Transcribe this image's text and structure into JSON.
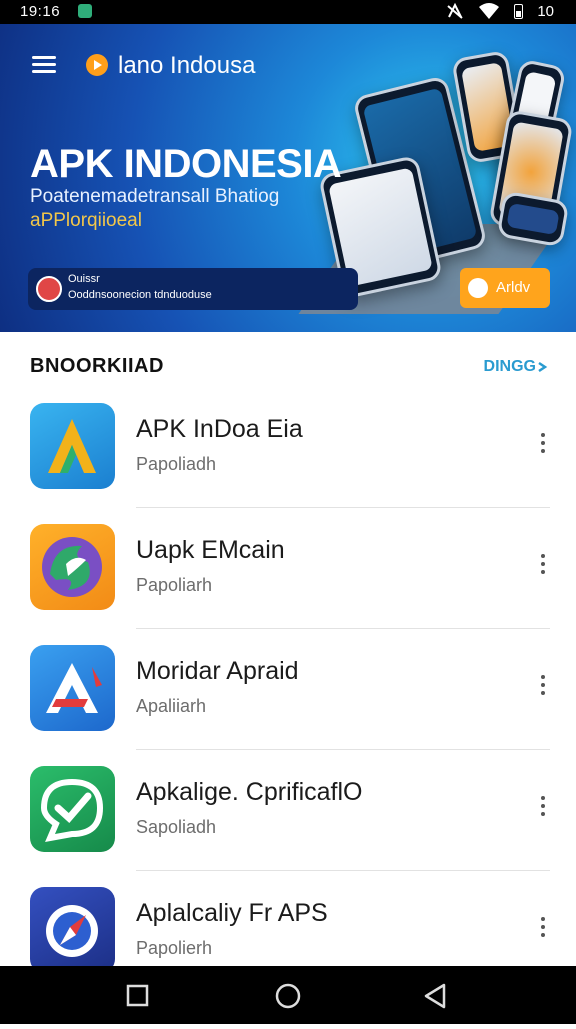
{
  "status_bar": {
    "time": "19:16",
    "battery": "10"
  },
  "header": {
    "brand": "lano Indousa"
  },
  "banner": {
    "title": "APK INDONESIA",
    "subtitle_line1": "Poatenemadetransall Bhatiog",
    "subtitle_line2": "aPPlorqiioeal",
    "promo_line1": "Ouissr",
    "promo_line2": "Ooddnsoonecion tdnduoduse",
    "cta_label": "Arldv"
  },
  "section": {
    "title": "BNOORKIIAD",
    "more": "DINGG"
  },
  "apps": [
    {
      "name": "APK InDoa Eia",
      "subtitle": "Papoliadh",
      "icon": "triangle-a-icon",
      "colors": [
        "#2aa2e8",
        "#f2b21a"
      ]
    },
    {
      "name": "Uapk EMcain",
      "subtitle": "Papoliarh",
      "icon": "swirl-icon",
      "colors": [
        "#f7a21b",
        "#2fa96a"
      ]
    },
    {
      "name": "Moridar Apraid",
      "subtitle": "Apaliiarh",
      "icon": "letter-a-icon",
      "colors": [
        "#2b8de6",
        "#e23c3c"
      ]
    },
    {
      "name": "Apkalige. CprificaflO",
      "subtitle": "Sapoliadh",
      "icon": "check-bubble-icon",
      "colors": [
        "#1fa25a",
        "#ffffff"
      ]
    },
    {
      "name": "Aplalcaliy Fr APS",
      "subtitle": "Papolierh",
      "icon": "compass-icon",
      "colors": [
        "#2845a8",
        "#e23c3c"
      ]
    }
  ],
  "nav": {
    "items": [
      "recent-apps-button",
      "home-button",
      "back-button"
    ]
  }
}
